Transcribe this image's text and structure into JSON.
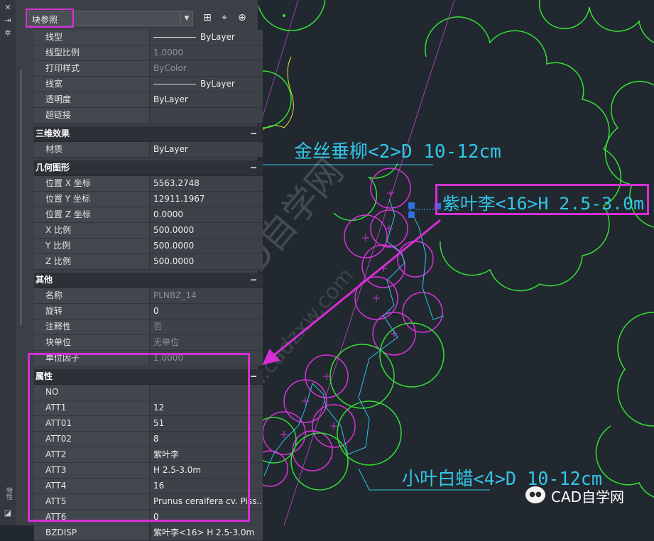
{
  "palette": {
    "object_type": "块参照",
    "toolbar_icons": [
      "quick-select-icon",
      "select-objects-icon",
      "toggle-pickadd-icon"
    ],
    "side_label": "特性"
  },
  "properties_top": [
    {
      "label": "线型",
      "value": "ByLayer",
      "line": true,
      "dim": false
    },
    {
      "label": "线型比例",
      "value": "1.0000",
      "dim": true
    },
    {
      "label": "打印样式",
      "value": "ByColor",
      "dim": true
    },
    {
      "label": "线宽",
      "value": "ByLayer",
      "line": true,
      "dim": false
    },
    {
      "label": "透明度",
      "value": "ByLayer",
      "dim": false
    },
    {
      "label": "超链接",
      "value": "",
      "dim": false
    }
  ],
  "sections": {
    "effects": {
      "title": "三维效果",
      "toggle": "−",
      "rows": [
        {
          "label": "材质",
          "value": "ByLayer"
        }
      ]
    },
    "geometry": {
      "title": "几何图形",
      "toggle": "−",
      "rows": [
        {
          "label": "位置 X 坐标",
          "value": "5563.2748"
        },
        {
          "label": "位置 Y 坐标",
          "value": "12911.1967"
        },
        {
          "label": "位置 Z 坐标",
          "value": "0.0000"
        },
        {
          "label": "X 比例",
          "value": "500.0000"
        },
        {
          "label": "Y 比例",
          "value": "500.0000"
        },
        {
          "label": "Z 比例",
          "value": "500.0000"
        }
      ]
    },
    "misc": {
      "title": "其他",
      "toggle": "−",
      "rows": [
        {
          "label": "名称",
          "value": "PLNBZ_14",
          "dim": true
        },
        {
          "label": "旋转",
          "value": "0"
        },
        {
          "label": "注释性",
          "value": "否",
          "dim": true
        },
        {
          "label": "块单位",
          "value": "无单位",
          "dim": true
        },
        {
          "label": "单位因子",
          "value": "1.0000",
          "dim": true
        }
      ]
    },
    "attributes": {
      "title": "属性",
      "toggle": "−",
      "rows": [
        {
          "label": "NO",
          "value": ""
        },
        {
          "label": "ATT1",
          "value": "12"
        },
        {
          "label": "ATT01",
          "value": "51"
        },
        {
          "label": "ATT02",
          "value": "8"
        },
        {
          "label": "ATT2",
          "value": "紫叶李"
        },
        {
          "label": "ATT3",
          "value": "H 2.5-3.0m"
        },
        {
          "label": "ATT4",
          "value": "16"
        },
        {
          "label": "ATT5",
          "value": "Prunus ceraifera cv. Piss..."
        },
        {
          "label": "ATT6",
          "value": "0"
        },
        {
          "label": "BZDISP",
          "value": "紫叶李<16> H 2.5-3.0m"
        }
      ]
    }
  },
  "drawing": {
    "label_1": "金丝垂柳<2>D 10-12cm",
    "label_2": "紫叶李<16>H 2.5-3.0m",
    "label_3": "小叶白蜡<4>D 10-12cm",
    "watermark": "CAD自学网",
    "watermark_url": "www.cadzxw.com",
    "colors": {
      "background": "#212830",
      "tree_outline": "#33e033",
      "purple_tree": "#d833d8",
      "leader": "#33c6e6",
      "highlight": "#d52fd5",
      "boundary": "#e6e633"
    }
  },
  "brand": {
    "name": "CAD自学网",
    "icon": "wechat-icon"
  }
}
